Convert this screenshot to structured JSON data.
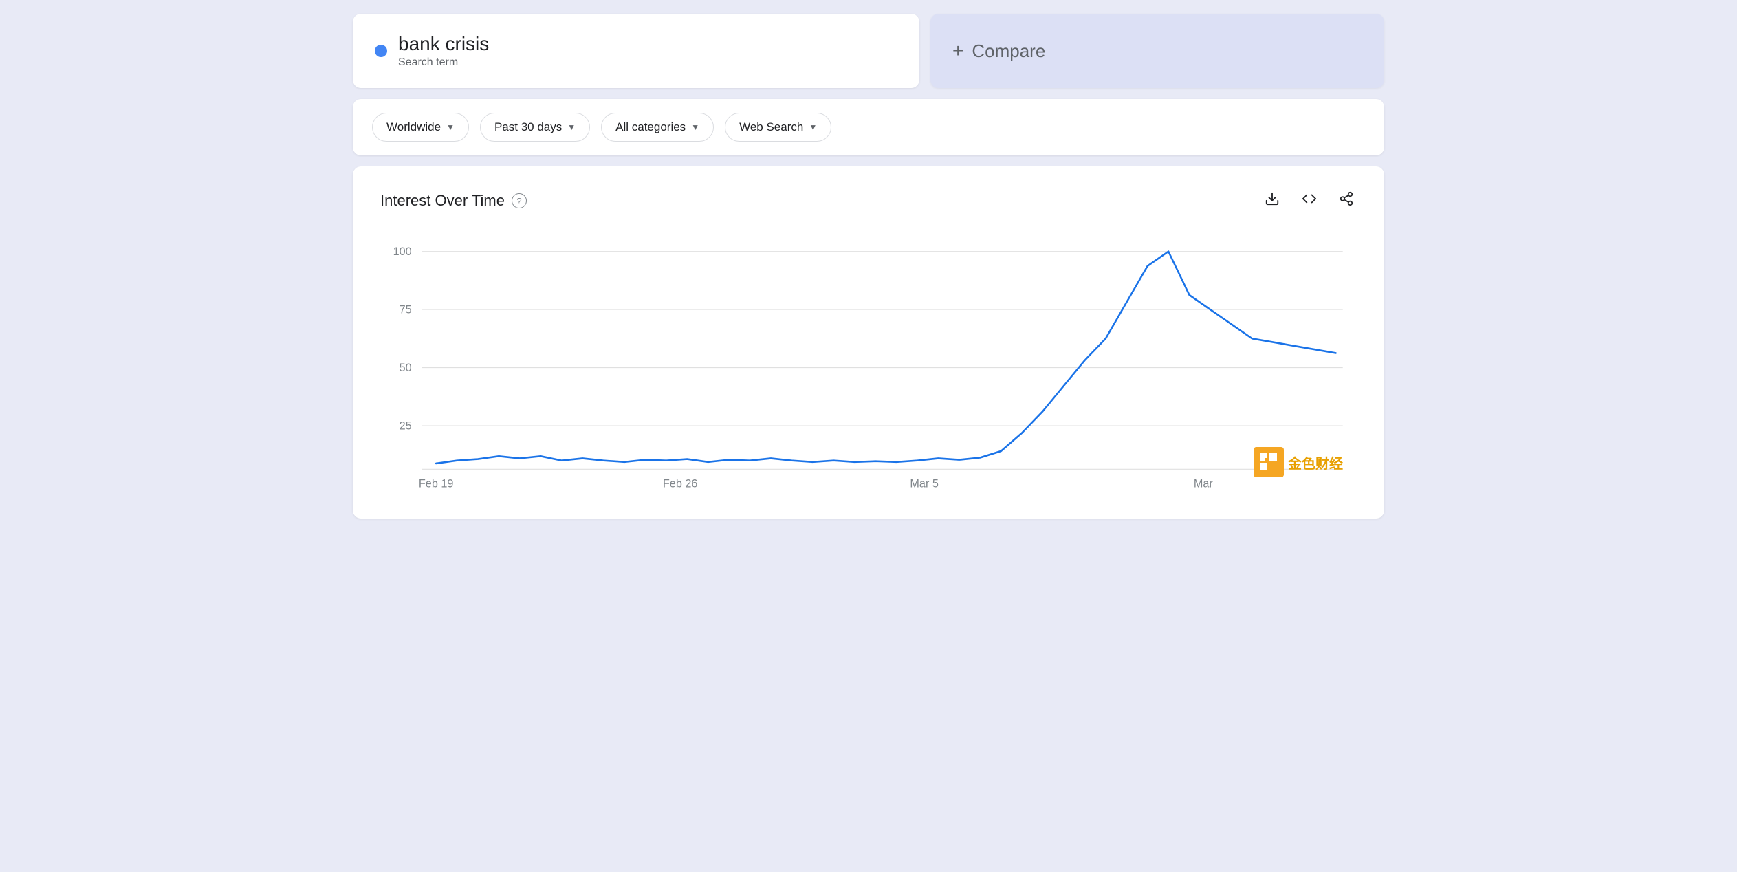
{
  "search_term": {
    "name": "bank crisis",
    "label": "Search term",
    "dot_color": "#4285f4"
  },
  "compare": {
    "plus": "+",
    "label": "Compare"
  },
  "filters": [
    {
      "id": "region",
      "label": "Worldwide",
      "has_chevron": true
    },
    {
      "id": "time",
      "label": "Past 30 days",
      "has_chevron": true
    },
    {
      "id": "category",
      "label": "All categories",
      "has_chevron": true
    },
    {
      "id": "type",
      "label": "Web Search",
      "has_chevron": true
    }
  ],
  "chart": {
    "title": "Interest Over Time",
    "help_text": "?",
    "y_labels": [
      "100",
      "75",
      "50",
      "25"
    ],
    "x_labels": [
      "Feb 19",
      "Feb 26",
      "Mar 5",
      "Mar"
    ],
    "download_icon": "⬇",
    "embed_icon": "<>",
    "share_icon": "⤢",
    "line_color": "#1a73e8",
    "grid_color": "#e0e0e0"
  },
  "watermark": {
    "text": "金色财经"
  }
}
